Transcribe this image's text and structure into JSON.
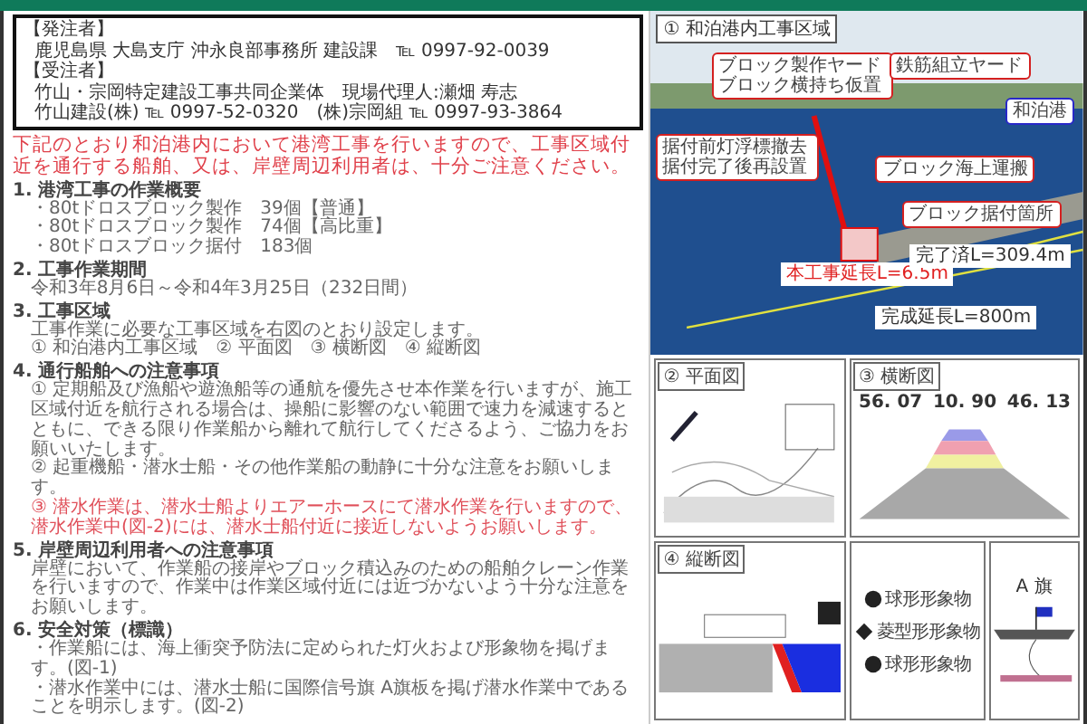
{
  "contact": {
    "orderer_heading": "【発注者】",
    "orderer": "鹿児島県 大島支庁 沖永良部事務所 建設課　℡ 0997-92-0039",
    "contractor_heading": "【受注者】",
    "contractor": "竹山・宗岡特定建設工事共同企業体　現場代理人:瀬畑 寿志",
    "phones": "竹山建設(株) ℡ 0997-52-0320　(株)宗岡組 ℡ 0997-93-3864"
  },
  "notice": "下記のとおり和泊港内において港湾工事を行いますので、工事区域付近を通行する船舶、又は、岸壁周辺利用者は、十分ご注意ください。",
  "sections": [
    {
      "heading": "1. 港湾工事の作業概要",
      "lines": [
        {
          "text": "・80tドロスブロック製作　39個【普通】",
          "emphasis": false
        },
        {
          "text": "・80tドロスブロック製作　74個【高比重】",
          "emphasis": false
        },
        {
          "text": "・80tドロスブロック据付　183個",
          "emphasis": false
        }
      ]
    },
    {
      "heading": "2. 工事作業期間",
      "lines": [
        {
          "text": "令和3年8月6日～令和4年3月25日（232日間）",
          "emphasis": false
        }
      ]
    },
    {
      "heading": "3. 工事区域",
      "lines": [
        {
          "text": "工事作業に必要な工事区域を右図のとおり設定します。",
          "emphasis": false
        },
        {
          "text": "① 和泊港内工事区域　② 平面図　③ 横断図　④ 縦断図",
          "emphasis": false
        }
      ]
    },
    {
      "heading": "4. 通行船舶への注意事項",
      "lines": [
        {
          "text": "① 定期船及び漁船や遊漁船等の通航を優先させ本作業を行いますが、施工区域付近を航行される場合は、操船に影響のない範囲で速力を減速するとともに、できる限り作業船から離れて航行してくださるよう、ご協力をお願いいたします。",
          "emphasis": false
        },
        {
          "text": "② 起重機船・潜水士船・その他作業船の動静に十分な注意をお願いします。",
          "emphasis": false
        },
        {
          "text": "③ 潜水作業は、潜水士船よりエアーホースにて潜水作業を行いますので、潜水作業中(図-2)には、潜水士船付近に接近しないようお願いします。",
          "emphasis": true
        }
      ]
    },
    {
      "heading": "5. 岸壁周辺利用者への注意事項",
      "lines": [
        {
          "text": "岸壁において、作業船の接岸やブロック積込みのための船舶クレーン作業を行いますので、作業中は作業区域付近には近づかないよう十分な注意をお願いします。",
          "emphasis": false
        }
      ]
    },
    {
      "heading": "6. 安全対策（標識）",
      "lines": [
        {
          "text": "・作業船には、海上衝突予防法に定められた灯火および形象物を掲げます。(図-1)",
          "emphasis": false
        },
        {
          "text": "・潜水作業中には、潜水士船に国際信号旗 A旗板を掲げ潜水作業中であることを明示します。(図-2)",
          "emphasis": false
        }
      ]
    }
  ],
  "photo_panel": {
    "label": "① 和泊港内工事区域",
    "callouts": [
      {
        "kind": "callout",
        "text": "ブロック製作ヤードブロック横持ち仮置",
        "color": "#d42020"
      },
      {
        "kind": "callout",
        "text": "鉄筋組立ヤード",
        "color": "#d42020"
      },
      {
        "kind": "callout",
        "text": "和泊港",
        "color": "#2828c8"
      },
      {
        "kind": "callout",
        "text": "据付前灯浮標撤去据付完了後再設置",
        "color": "#d42020"
      },
      {
        "kind": "callout",
        "text": "ブロック海上運搬",
        "color": "#d42020"
      },
      {
        "kind": "callout",
        "text": "ブロック据付箇所",
        "color": "#d42020"
      },
      {
        "kind": "length",
        "text": "本工事延長L=6.5m",
        "color": "#e02020"
      },
      {
        "kind": "length",
        "text": "完了済L=309.4m",
        "color": "#333333"
      },
      {
        "kind": "length",
        "text": "完成延長L=800m",
        "color": "#333333"
      }
    ]
  },
  "plan": {
    "label": "② 平面図"
  },
  "cross_section": {
    "label": "③ 横断図",
    "width": "10. 90",
    "left": "56. 07",
    "right": "46. 13"
  },
  "longitudinal": {
    "label": "④ 縦断図"
  },
  "shapes": {
    "items": [
      {
        "kind": "ball",
        "text": "球形形象物"
      },
      {
        "kind": "diamond",
        "text": "菱型形形象物"
      },
      {
        "kind": "ball",
        "text": "球形形象物"
      }
    ]
  },
  "flag": {
    "label": "A 旗"
  }
}
